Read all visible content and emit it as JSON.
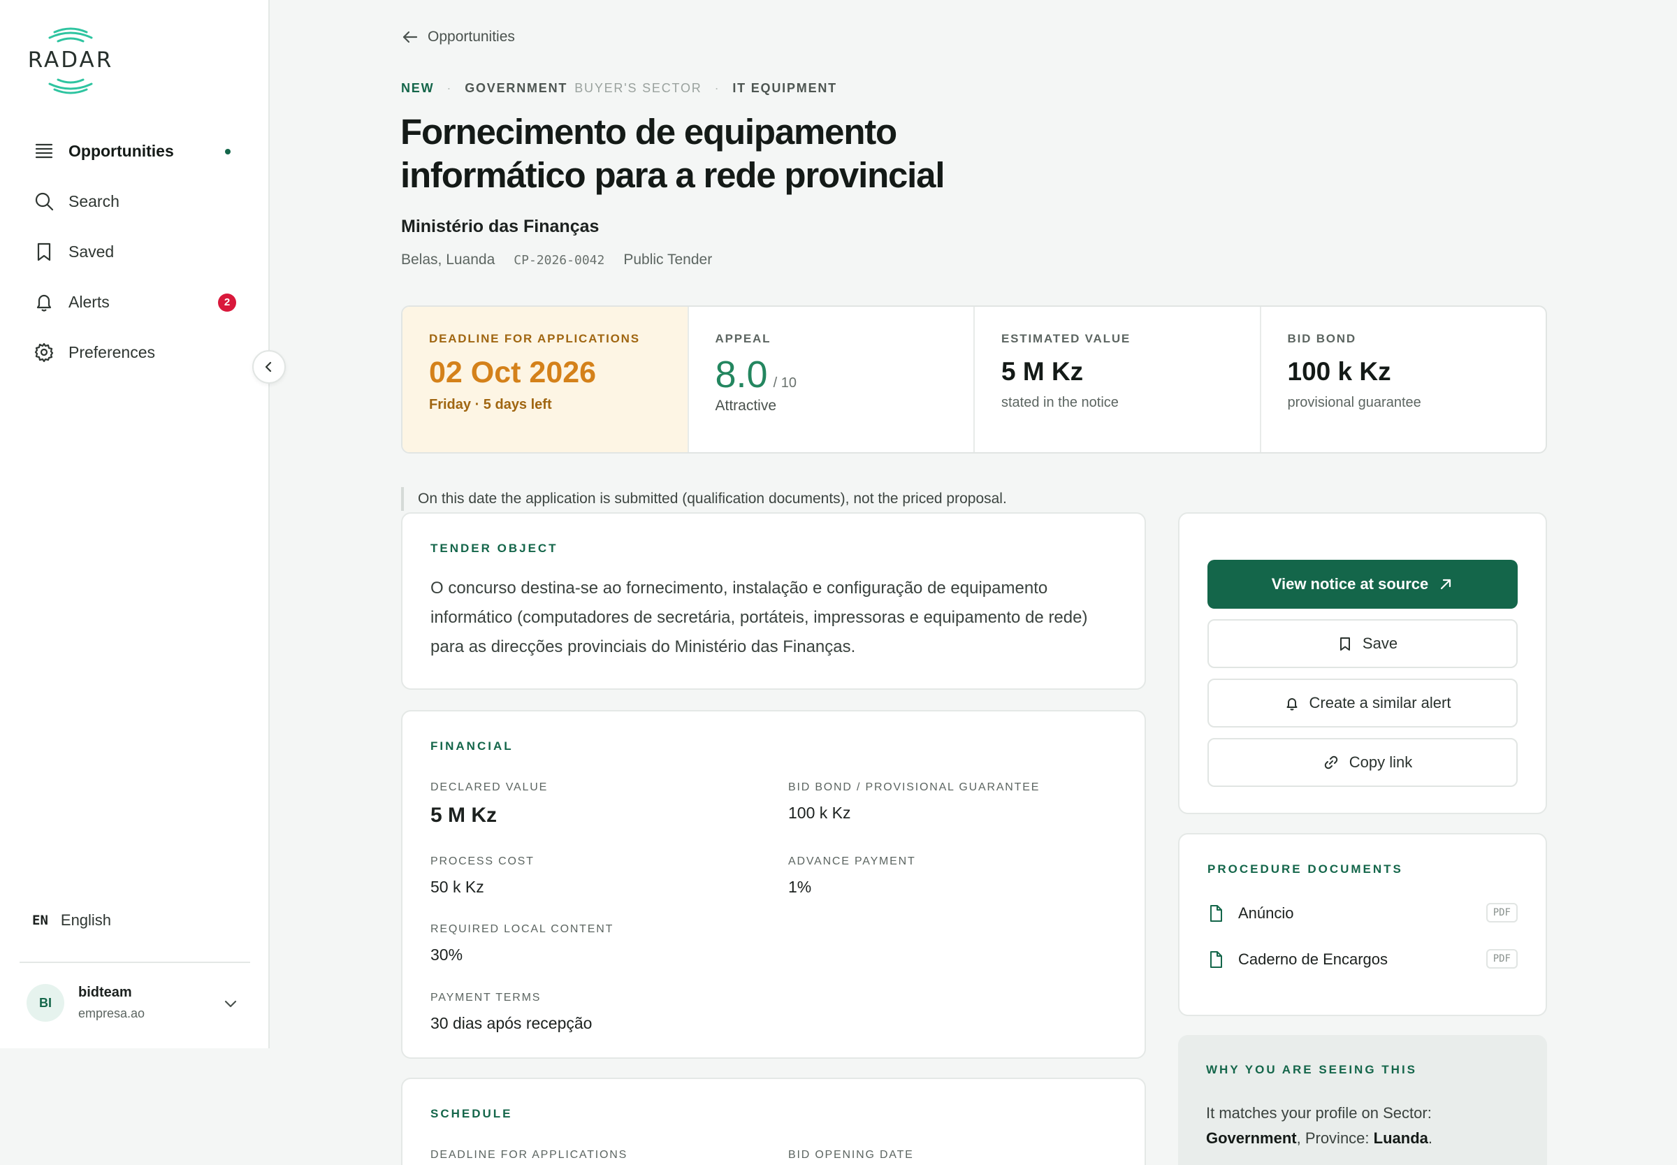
{
  "app": {
    "logo_text": "RADAR"
  },
  "sidebar": {
    "items": [
      {
        "label": "Opportunities",
        "icon": "list-icon",
        "active": true
      },
      {
        "label": "Search",
        "icon": "search-icon"
      },
      {
        "label": "Saved",
        "icon": "bookmark-icon"
      },
      {
        "label": "Alerts",
        "icon": "bell-icon",
        "badge": "2"
      },
      {
        "label": "Preferences",
        "icon": "gear-icon"
      }
    ],
    "language": {
      "code": "EN",
      "name": "English"
    },
    "user": {
      "initials": "BI",
      "name": "bidteam",
      "org": "empresa.ao"
    }
  },
  "header": {
    "back_label": "Opportunities",
    "tags": {
      "status": "NEW",
      "sector": "GOVERNMENT",
      "sector_hint": "BUYER'S SECTOR",
      "category": "IT EQUIPMENT"
    },
    "title": "Fornecimento de equipamento informático para a rede provincial",
    "buyer": "Ministério das Finanças",
    "location": "Belas, Luanda",
    "reference": "CP-2026-0042",
    "procedure": "Public Tender"
  },
  "kpis": {
    "deadline": {
      "label": "DEADLINE FOR APPLICATIONS",
      "value": "02 Oct 2026",
      "sub": "Friday · 5 days left"
    },
    "appeal": {
      "label": "APPEAL",
      "value": "8.0",
      "denominator": "/ 10",
      "sub": "Attractive"
    },
    "estimated": {
      "label": "ESTIMATED VALUE",
      "value": "5 M Kz",
      "sub": "stated in the notice"
    },
    "bond": {
      "label": "BID BOND",
      "value": "100 k Kz",
      "sub": "provisional guarantee"
    }
  },
  "note": "On this date the application is submitted (qualification documents), not the priced proposal.",
  "object": {
    "heading": "TENDER OBJECT",
    "text": "O concurso destina-se ao fornecimento, instalação e configuração de equipamento informático (computadores de secretária, portáteis, impressoras e equipamento de rede) para as direcções provinciais do Ministério das Finanças."
  },
  "financial": {
    "heading": "FINANCIAL",
    "declared_value": {
      "label": "DECLARED VALUE",
      "value": "5 M Kz"
    },
    "bid_bond": {
      "label": "BID BOND / PROVISIONAL GUARANTEE",
      "value": "100 k Kz"
    },
    "process_cost": {
      "label": "PROCESS COST",
      "value": "50 k Kz"
    },
    "advance_payment": {
      "label": "ADVANCE PAYMENT",
      "value": "1%"
    },
    "local_content": {
      "label": "REQUIRED LOCAL CONTENT",
      "value": "30%"
    },
    "payment_terms": {
      "label": "PAYMENT TERMS",
      "value": "30 dias após recepção"
    }
  },
  "schedule": {
    "heading": "SCHEDULE",
    "col1_label": "DEADLINE FOR APPLICATIONS",
    "col2_label": "BID OPENING DATE"
  },
  "actions": {
    "view_source": "View notice at source",
    "save": "Save",
    "create_alert": "Create a similar alert",
    "copy_link": "Copy link"
  },
  "documents": {
    "heading": "PROCEDURE DOCUMENTS",
    "items": [
      {
        "name": "Anúncio",
        "type": "PDF"
      },
      {
        "name": "Caderno de Encargos",
        "type": "PDF"
      }
    ]
  },
  "why": {
    "heading": "WHY YOU ARE SEEING THIS",
    "text_prefix": "It matches your profile on Sector:",
    "sector": "Government",
    "province_prefix": ", Province:",
    "province": "Luanda",
    "suffix": "."
  },
  "colors": {
    "accent": "#14664a",
    "deadline": "#d4811a",
    "alert_badge": "#d9183b"
  }
}
